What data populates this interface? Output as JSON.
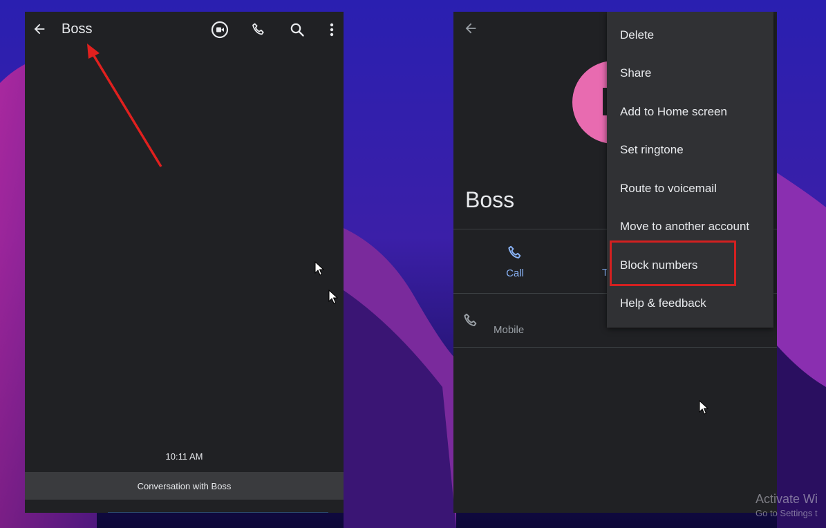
{
  "left_screen": {
    "contact_title": "Boss",
    "timestamp": "10:11 AM",
    "conversation_label": "Conversation with Boss",
    "icons": {
      "back": "arrow-back-icon",
      "video": "video-call-icon",
      "phone": "phone-icon",
      "search": "search-icon",
      "more": "more-vert-icon"
    }
  },
  "right_screen": {
    "contact_name": "Boss",
    "actions": {
      "call_label": "Call",
      "partial_label": "T"
    },
    "phone_row": {
      "type_label": "Mobile"
    },
    "menu": {
      "items": [
        "Delete",
        "Share",
        "Add to Home screen",
        "Set ringtone",
        "Route to voicemail",
        "Move to another account",
        "Block numbers",
        "Help & feedback"
      ],
      "highlighted": "Block numbers"
    }
  },
  "annotation": {
    "arrow_color": "#e0201e",
    "highlight_color": "#d42020"
  },
  "watermark": {
    "title": "Activate Wi",
    "subtitle": "Go to Settings t"
  },
  "colors": {
    "app_background": "#202124",
    "accent": "#8ab4f8",
    "avatar": "#e86bb0"
  }
}
